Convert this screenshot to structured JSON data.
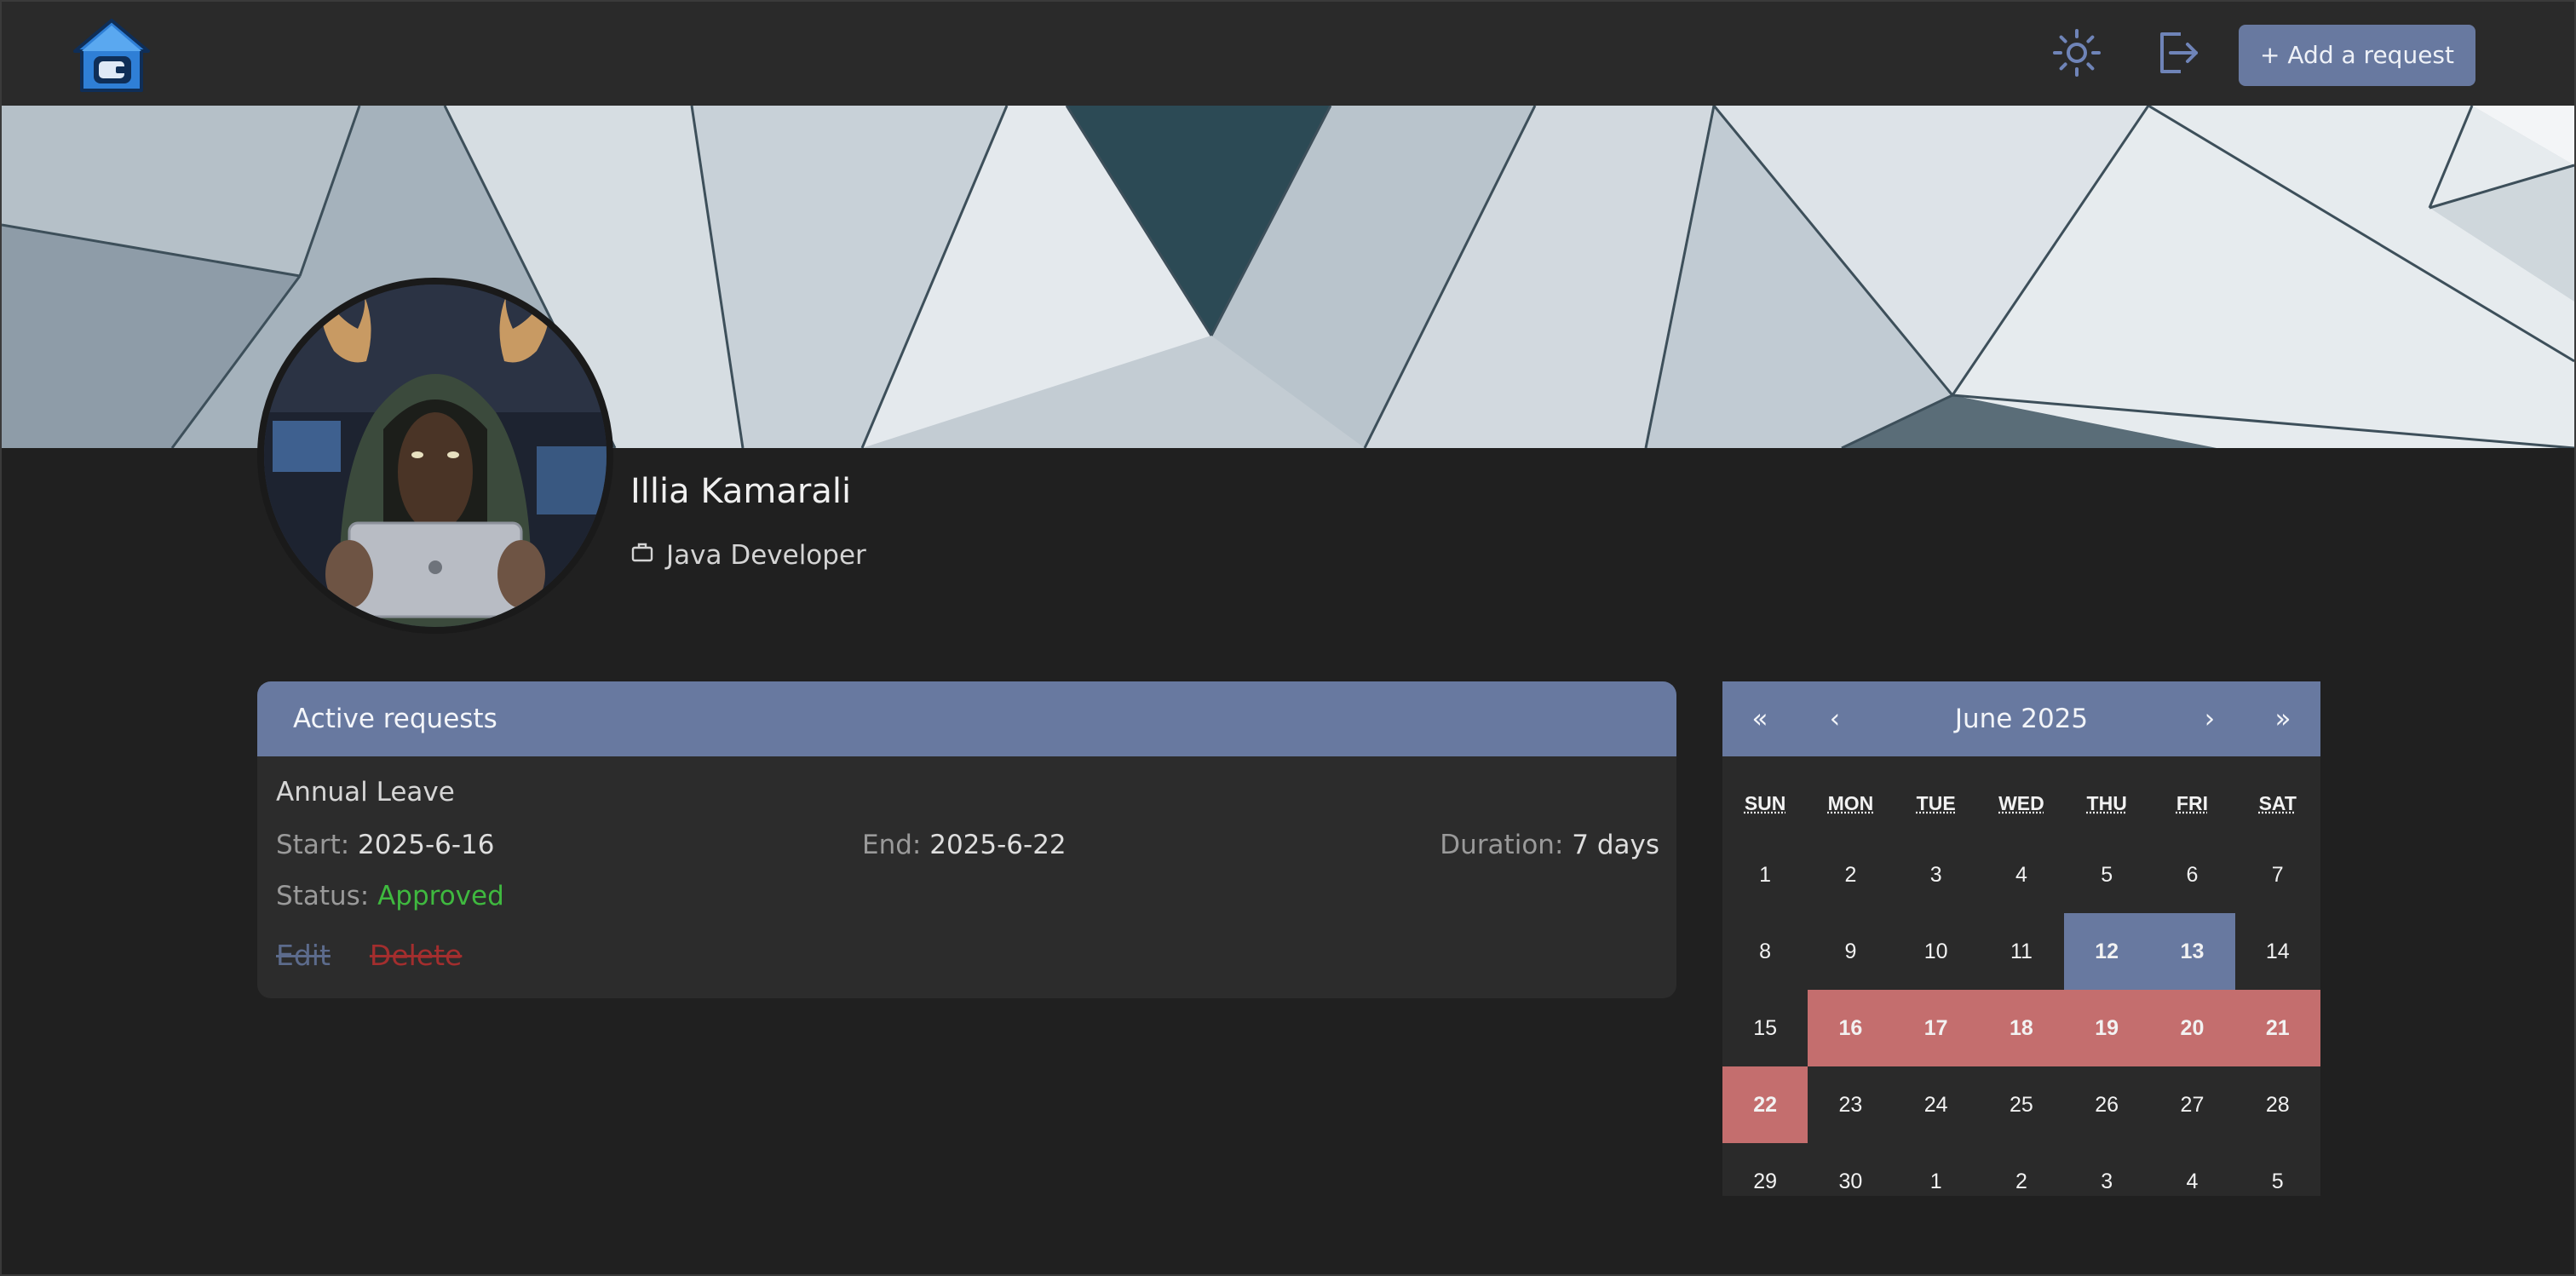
{
  "header": {
    "add_request_label": "+ Add a request",
    "icons": [
      "house-logo-icon",
      "sun-icon",
      "logout-icon"
    ]
  },
  "profile": {
    "name": "Illia Kamarali",
    "role": "Java Developer"
  },
  "requests": {
    "title": "Active requests",
    "items": [
      {
        "type": "Annual Leave",
        "start_label": "Start:",
        "start": "2025-6-16",
        "end_label": "End:",
        "end": "2025-6-22",
        "duration_label": "Duration:",
        "duration": "7 days",
        "status_label": "Status:",
        "status": "Approved",
        "edit_label": "Edit",
        "delete_label": "Delete"
      }
    ]
  },
  "calendar": {
    "nav": {
      "prev_year": "«",
      "prev": "‹",
      "next": "›",
      "next_year": "»"
    },
    "month_label": "June 2025",
    "weekdays": [
      "SUN",
      "MON",
      "TUE",
      "WED",
      "THU",
      "FRI",
      "SAT"
    ],
    "weeks": [
      [
        "1",
        "2",
        "3",
        "4",
        "5",
        "6",
        "7"
      ],
      [
        "8",
        "9",
        "10",
        "11",
        "12",
        "13",
        "14"
      ],
      [
        "15",
        "16",
        "17",
        "18",
        "19",
        "20",
        "21"
      ],
      [
        "22",
        "23",
        "24",
        "25",
        "26",
        "27",
        "28"
      ],
      [
        "29",
        "30",
        "1",
        "2",
        "3",
        "4",
        "5"
      ]
    ],
    "highlight_blue": [
      "12",
      "13"
    ],
    "highlight_red": [
      "16",
      "17",
      "18",
      "19",
      "20",
      "21",
      "22"
    ],
    "colors": {
      "blue": "#6879a0",
      "red": "#c46e6e",
      "approved": "#3fb93f"
    }
  }
}
